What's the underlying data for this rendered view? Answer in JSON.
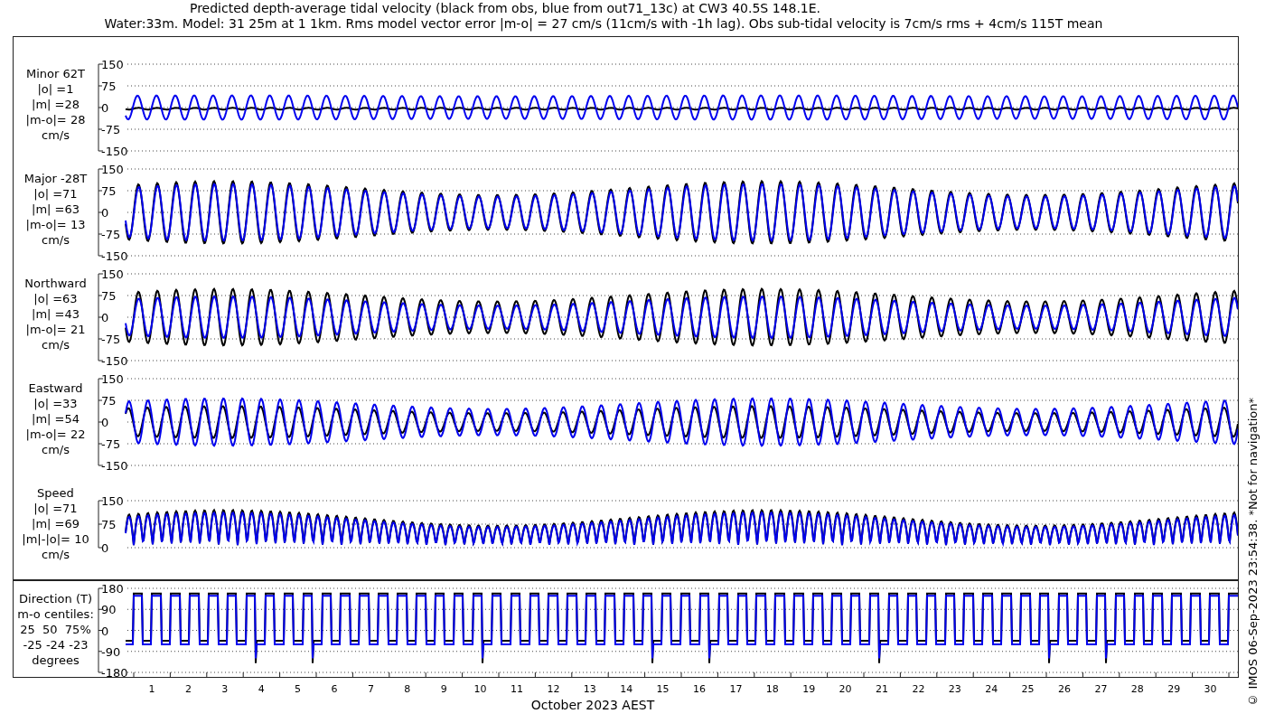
{
  "title": {
    "lines": [
      "Predicted depth-average tidal velocity (black from obs, blue from out71_13c) at CW3 40.5S 148.1E.",
      "Water:33m. Model: 31 25m at 1 1km. Rms model vector error |m-o| = 27 cm/s (11cm/s with -1h lag). Obs sub-tidal velocity is 7cm/s rms + 4cm/s 115T mean"
    ]
  },
  "panels": [
    {
      "kind": "minor",
      "label_lines": [
        "Minor 62T",
        "|o| =1",
        "|m| =28",
        "|m-o|= 28",
        "cm/s"
      ],
      "yticks": [
        "150",
        "75",
        "0",
        "-75",
        "-150"
      ]
    },
    {
      "kind": "major",
      "label_lines": [
        "Major -28T",
        "|o| =71",
        "|m| =63",
        "|m-o|= 13",
        "cm/s"
      ],
      "yticks": [
        "150",
        "75",
        "0",
        "-75",
        "-150"
      ]
    },
    {
      "kind": "northward",
      "label_lines": [
        "Northward",
        "|o| =63",
        "|m| =43",
        "|m-o|= 21",
        "cm/s"
      ],
      "yticks": [
        "150",
        "75",
        "0",
        "-75",
        "-150"
      ]
    },
    {
      "kind": "eastward",
      "label_lines": [
        "Eastward",
        "|o| =33",
        "|m| =54",
        "|m-o|= 22",
        "cm/s"
      ],
      "yticks": [
        "150",
        "75",
        "0",
        "-75",
        "-150"
      ]
    },
    {
      "kind": "speed",
      "label_lines": [
        "Speed",
        "|o| =71",
        "|m| =69",
        "|m|-|o|= 10",
        "cm/s"
      ],
      "yticks": [
        "150",
        "75",
        "0"
      ]
    },
    {
      "kind": "direction",
      "label_lines": [
        "Direction (T)",
        "m-o centiles:",
        "25  50  75%",
        "-25 -24 -23",
        "degrees"
      ],
      "yticks": [
        "180",
        "90",
        "0",
        "-90",
        "-180"
      ]
    }
  ],
  "xaxis": {
    "ticks": [
      "1",
      "2",
      "3",
      "4",
      "5",
      "6",
      "7",
      "8",
      "9",
      "10",
      "11",
      "12",
      "13",
      "14",
      "15",
      "16",
      "17",
      "18",
      "19",
      "20",
      "21",
      "22",
      "23",
      "24",
      "25",
      "26",
      "27",
      "28",
      "29",
      "30"
    ],
    "label": "October 2023 AEST"
  },
  "footer_note": "© IMOS 06-Sep-2023 23:54:38. *Not for navigation*"
}
